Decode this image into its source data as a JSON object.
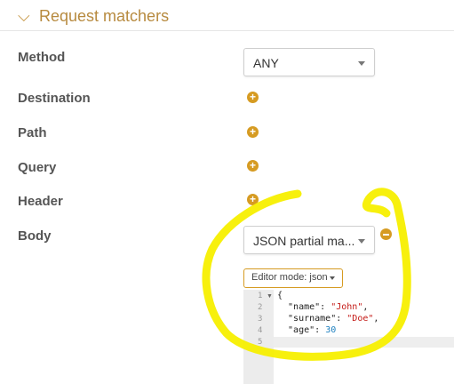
{
  "section": {
    "title": "Request matchers"
  },
  "fields": {
    "method": {
      "label": "Method",
      "value": "ANY"
    },
    "destination": {
      "label": "Destination"
    },
    "path": {
      "label": "Path"
    },
    "query": {
      "label": "Query"
    },
    "header": {
      "label": "Header"
    },
    "body": {
      "label": "Body",
      "value": "JSON partial ma..."
    }
  },
  "editor": {
    "mode_label": "Editor mode: json",
    "line_numbers": [
      "1",
      "2",
      "3",
      "4",
      "5"
    ],
    "lines": [
      {
        "pre": "{",
        "key": "",
        "val": "",
        "post": ""
      },
      {
        "pre": "  \"name\": ",
        "val": "\"John\"",
        "post": ","
      },
      {
        "pre": "  \"surname\": ",
        "val": "\"Doe\"",
        "post": ","
      },
      {
        "pre": "  \"age\": ",
        "val": "30",
        "post": ""
      },
      {
        "pre": "}",
        "val": "",
        "post": ""
      }
    ]
  },
  "colors": {
    "accent": "#d69b22",
    "highlight": "#f7ef00"
  }
}
